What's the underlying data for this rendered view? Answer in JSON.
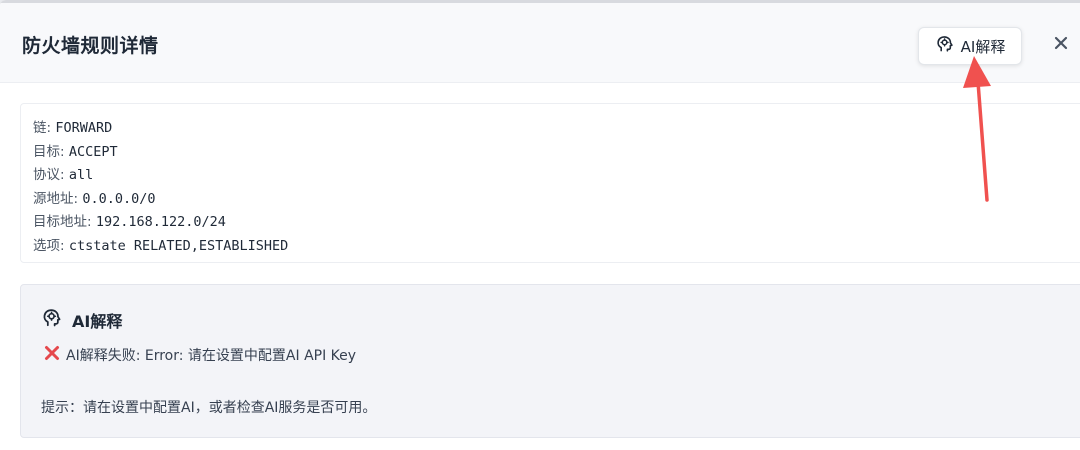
{
  "dialog": {
    "title": "防火墙规则详情",
    "ai_button_label": "AI解释",
    "close_glyph": "×"
  },
  "rule": {
    "lines": [
      {
        "key": "链:",
        "value": "FORWARD"
      },
      {
        "key": "目标:",
        "value": "ACCEPT"
      },
      {
        "key": "协议:",
        "value": "all"
      },
      {
        "key": "源地址:",
        "value": "0.0.0.0/0"
      },
      {
        "key": "目标地址:",
        "value": "192.168.122.0/24"
      },
      {
        "key": "选项:",
        "value": "ctstate RELATED,ESTABLISHED"
      }
    ]
  },
  "ai_panel": {
    "title": "AI解释",
    "error": "AI解释失败: Error: 请在设置中配置AI API Key",
    "hint": "提示：请在设置中配置AI，或者检查AI服务是否可用。"
  },
  "icons": {
    "ai_button_icon": "ai-brain-icon",
    "panel_icon": "ai-brain-icon",
    "error_icon": "red-cross-icon",
    "close_icon": "close-icon"
  },
  "colors": {
    "arrow": "#f0514f",
    "error_cross": "#e5484d",
    "panel_bg": "#f3f4f8"
  }
}
